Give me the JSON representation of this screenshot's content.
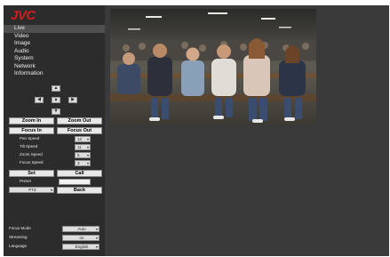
{
  "brand": {
    "logo_text": "JVC",
    "logo_color": "#d21c1c"
  },
  "menu": {
    "items": [
      {
        "label": "Live",
        "active": true
      },
      {
        "label": "Video"
      },
      {
        "label": "Image"
      },
      {
        "label": "Audio"
      },
      {
        "label": "System"
      },
      {
        "label": "Network"
      },
      {
        "label": "Information"
      }
    ]
  },
  "ptz": {
    "arrows": {
      "up": "▲",
      "down": "▼",
      "left": "◀",
      "right": "▶",
      "home": "▲"
    },
    "zoom_in": "Zoom In",
    "zoom_out": "Zoom Out",
    "focus_in": "Focus In",
    "focus_out": "Focus Out",
    "pan_speed_label": "Pan Speed",
    "pan_speed_value": "12",
    "tilt_speed_label": "Tilt Speed",
    "tilt_speed_value": "11",
    "zoom_speed_label": "Zoom Speed",
    "zoom_speed_value": "5",
    "focus_speed_label": "Focus Speed",
    "focus_speed_value": "3",
    "set_label": "Set",
    "call_label": "Call",
    "preset_label": "Preset",
    "mode_value": "PTZ",
    "back_label": "Back"
  },
  "bottom": {
    "focus_mode_label": "Focus Mode",
    "focus_mode_value": "Auto",
    "streaming_label": "Streaming",
    "streaming_value": "on",
    "language_label": "Language",
    "language_value": "English"
  },
  "colors": {
    "sidebar_bg": "#2c2c2c",
    "content_bg": "#3a3a3a",
    "active_item_bg": "#4f4f4f"
  }
}
